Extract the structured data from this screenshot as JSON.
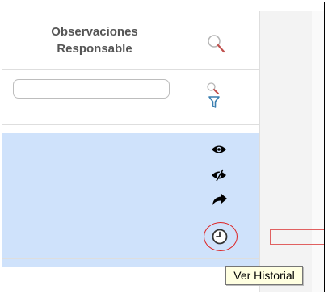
{
  "table": {
    "column_header": "Observaciones\nResponsable",
    "filter_input": {
      "value": "",
      "placeholder": ""
    }
  },
  "actions": [
    {
      "icon": "eye-icon"
    },
    {
      "icon": "eye-slash-icon"
    },
    {
      "icon": "share-arrow-icon"
    },
    {
      "icon": "clock-history-icon"
    }
  ],
  "tooltip": {
    "text": "Ver Historial"
  },
  "colors": {
    "selected_row": "#cfe2fb",
    "highlight_red": "#d22222",
    "tooltip_bg": "#ffffe1"
  }
}
